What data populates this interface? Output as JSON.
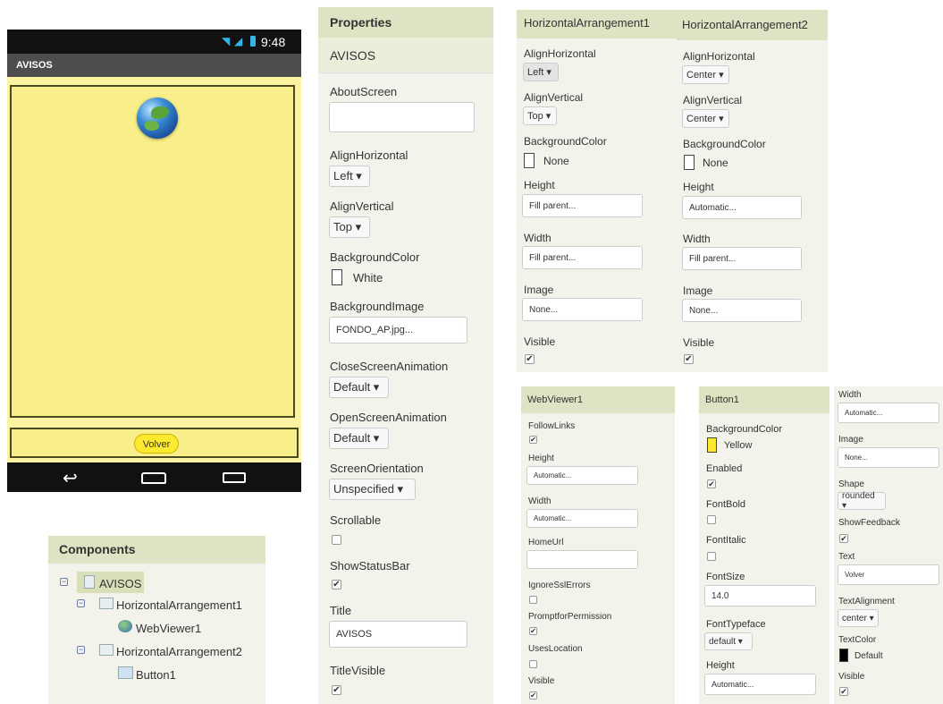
{
  "phone": {
    "status_time": "9:48",
    "screen_title": "AVISOS",
    "button_label": "Volver",
    "icons": [
      "wifi-icon",
      "signal-icon",
      "battery-icon",
      "back-icon",
      "home-icon",
      "recent-apps-icon",
      "globe-icon"
    ]
  },
  "components": {
    "header": "Components",
    "items": [
      "AVISOS",
      "HorizontalArrangement1",
      "WebViewer1",
      "HorizontalArrangement2",
      "Button1"
    ]
  },
  "properties": {
    "header": "Properties",
    "component": "AVISOS",
    "about_label": "AboutScreen",
    "about_value": "",
    "align_h_label": "AlignHorizontal",
    "align_h_value": "Left ▾",
    "align_v_label": "AlignVertical",
    "align_v_value": "Top ▾",
    "bg_color_label": "BackgroundColor",
    "bg_color_value": "White",
    "bg_image_label": "BackgroundImage",
    "bg_image_value": "FONDO_AP.jpg...",
    "close_anim_label": "CloseScreenAnimation",
    "close_anim_value": "Default ▾",
    "open_anim_label": "OpenScreenAnimation",
    "open_anim_value": "Default ▾",
    "orientation_label": "ScreenOrientation",
    "orientation_value": "Unspecified ▾",
    "scrollable_label": "Scrollable",
    "statusbar_label": "ShowStatusBar",
    "title_label": "Title",
    "title_value": "AVISOS",
    "title_visible_label": "TitleVisible"
  },
  "ha1": {
    "header": "HorizontalArrangement1",
    "align_h_label": "AlignHorizontal",
    "align_h_value": "Left ▾",
    "align_v_label": "AlignVertical",
    "align_v_value": "Top ▾",
    "bg_color_label": "BackgroundColor",
    "bg_color_value": "None",
    "height_label": "Height",
    "height_value": "Fill parent...",
    "width_label": "Width",
    "width_value": "Fill parent...",
    "image_label": "Image",
    "image_value": "None...",
    "visible_label": "Visible"
  },
  "ha2": {
    "header": "HorizontalArrangement2",
    "align_h_label": "AlignHorizontal",
    "align_h_value": "Center ▾",
    "align_v_label": "AlignVertical",
    "align_v_value": "Center ▾",
    "bg_color_label": "BackgroundColor",
    "bg_color_value": "None",
    "height_label": "Height",
    "height_value": "Automatic...",
    "width_label": "Width",
    "width_value": "Fill parent...",
    "image_label": "Image",
    "image_value": "None...",
    "visible_label": "Visible"
  },
  "webviewer": {
    "header": "WebViewer1",
    "follow_label": "FollowLinks",
    "height_label": "Height",
    "height_value": "Automatic...",
    "width_label": "Width",
    "width_value": "Automatic...",
    "homeurl_label": "HomeUrl",
    "homeurl_value": "",
    "ignore_label": "IgnoreSslErrors",
    "prompt_label": "PromptforPermission",
    "location_label": "UsesLocation",
    "visible_label": "Visible"
  },
  "button1": {
    "header": "Button1",
    "bg_color_label": "BackgroundColor",
    "bg_color_value": "Yellow",
    "enabled_label": "Enabled",
    "bold_label": "FontBold",
    "italic_label": "FontItalic",
    "size_label": "FontSize",
    "size_value": "14.0",
    "typeface_label": "FontTypeface",
    "typeface_value": "default ▾",
    "height_label": "Height",
    "height_value": "Automatic...",
    "width_label": "Width",
    "width_value": "Automatic...",
    "image_label": "Image",
    "image_value": "None...",
    "shape_label": "Shape",
    "shape_value": "rounded ▾",
    "feedback_label": "ShowFeedback",
    "text_label": "Text",
    "text_value": "Volver",
    "align_label": "TextAlignment",
    "align_value": "center ▾",
    "textcolor_label": "TextColor",
    "textcolor_value": "Default",
    "visible_label": "Visible"
  },
  "colors": {
    "screen_bg": "#fcf3a2",
    "button_yellow": "#fde92f",
    "panel_header": "#dfe3c4",
    "panel_bg": "#f3f3ec"
  }
}
